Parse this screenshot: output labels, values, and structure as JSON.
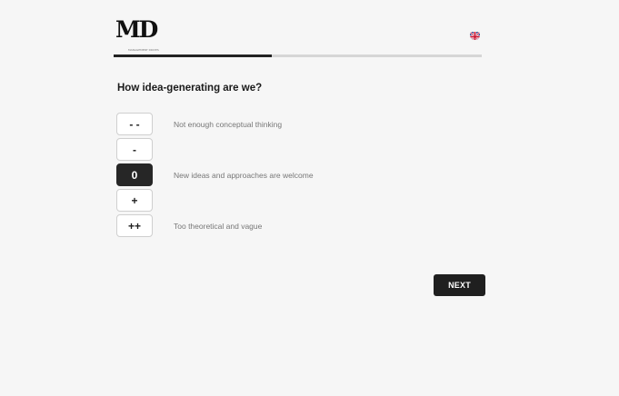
{
  "header": {
    "logo_text": "MD",
    "logo_tagline": "MANAGEMENT DRIVES",
    "language_icon": "uk-flag-icon"
  },
  "progress": {
    "fraction": 0.43
  },
  "question": {
    "title": "How idea-generating are we?"
  },
  "options": [
    {
      "label": "- -",
      "description": "Not enough conceptual thinking",
      "selected": false
    },
    {
      "label": "-",
      "description": "",
      "selected": false
    },
    {
      "label": "0",
      "description": "New ideas and approaches are welcome",
      "selected": true
    },
    {
      "label": "+",
      "description": "",
      "selected": false
    },
    {
      "label": "++",
      "description": "Too theoretical and vague",
      "selected": false
    }
  ],
  "footer": {
    "next_label": "NEXT"
  },
  "colors": {
    "background": "#f6f6f6",
    "accent_dark": "#262626",
    "progress_track": "#d6d6d6"
  }
}
